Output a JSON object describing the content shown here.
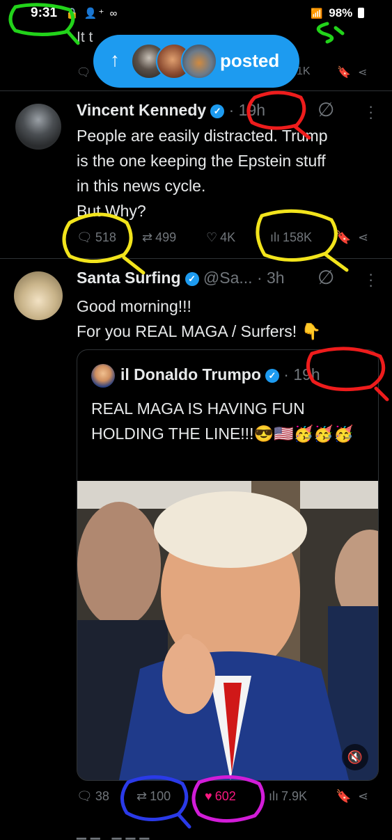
{
  "status_bar": {
    "time": "9:31",
    "battery": "98%"
  },
  "prev_tweet": {
    "text_fragment": "It t",
    "views": "1K"
  },
  "new_posts_pill": {
    "label": "posted"
  },
  "tweets": [
    {
      "name": "Vincent Kennedy",
      "meta": "· 19h",
      "text": "People are easily distracted. Trump\nis the one keeping the Epstein stuff\nin this news cycle.\nBut Why?",
      "replies": "518",
      "reposts": "499",
      "likes": "4K",
      "views": "158K"
    },
    {
      "name": "Santa Surfing",
      "meta": "@Sa... · 3h",
      "text": "Good morning!!!\nFor you REAL MAGA / Surfers! 👇",
      "quote": {
        "name": "il Donaldo Trumpo",
        "meta": "· 19h",
        "text": "REAL MAGA IS HAVING FUN HOLDING THE LINE!!!😎🇺🇸🥳🥳🥳"
      },
      "replies": "38",
      "reposts": "100",
      "likes": "602",
      "views": "7.9K"
    }
  ],
  "colors": {
    "accent": "#1d9bf0",
    "like": "#f91880",
    "muted": "#71767b",
    "divider": "#2f3336"
  }
}
